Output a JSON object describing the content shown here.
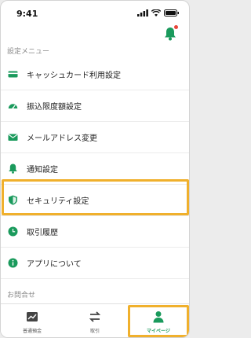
{
  "status_bar": {
    "time": "9:41"
  },
  "section_settings": "設定メニュー",
  "menu": [
    {
      "label": "キャッシュカード利用設定",
      "icon": "card-icon"
    },
    {
      "label": "振込限度額設定",
      "icon": "gauge-icon"
    },
    {
      "label": "メールアドレス変更",
      "icon": "mail-icon"
    },
    {
      "label": "通知設定",
      "icon": "bell-icon"
    },
    {
      "label": "セキュリティ設定",
      "icon": "shield-icon"
    },
    {
      "label": "取引履歴",
      "icon": "clock-icon"
    },
    {
      "label": "アプリについて",
      "icon": "info-icon"
    }
  ],
  "section_contact": "お問合せ",
  "tabs": [
    {
      "label": "普通預金",
      "icon": "chart-icon"
    },
    {
      "label": "取引",
      "icon": "transfer-icon"
    },
    {
      "label": "マイページ",
      "icon": "person-icon"
    }
  ],
  "colors": {
    "accent": "#1a9a5c",
    "highlight": "#f0b02c",
    "badge": "#e8463a"
  }
}
